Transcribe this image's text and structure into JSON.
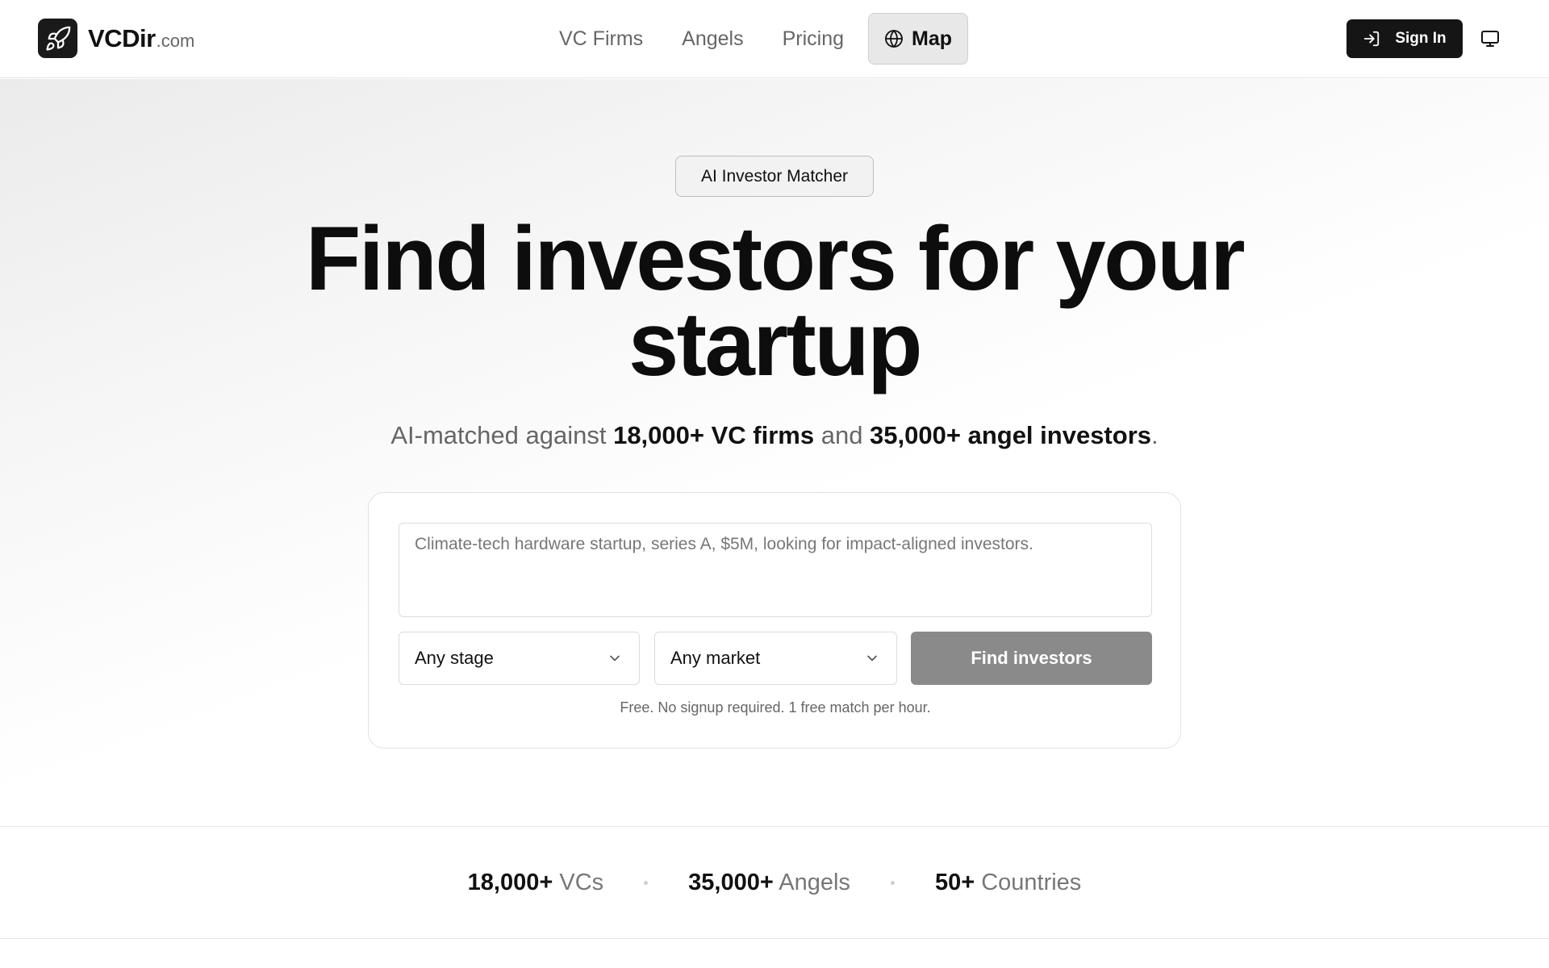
{
  "brand": {
    "name": "VCDir",
    "suffix": ".com",
    "icon": "rocket-icon"
  },
  "nav": {
    "links": [
      {
        "label": "VC Firms"
      },
      {
        "label": "Angels"
      },
      {
        "label": "Pricing"
      }
    ],
    "map": {
      "label": "Map",
      "icon": "globe-icon"
    }
  },
  "header": {
    "sign_in": {
      "label": "Sign In",
      "icon": "log-in-icon"
    },
    "theme_toggle": {
      "icon": "monitor-icon"
    }
  },
  "hero": {
    "badge": "AI Investor Matcher",
    "headline_line1": "Find investors for your",
    "headline_line2": "startup",
    "sub": {
      "prefix": "AI-matched against ",
      "vc_count": "18,000+ VC firms",
      "middle": " and ",
      "angel_count": "35,000+ angel investors",
      "suffix": "."
    }
  },
  "search": {
    "placeholder": "Climate-tech hardware startup, series A, $5M, looking for impact-aligned investors.",
    "value": "",
    "stage": {
      "selected": "Any stage"
    },
    "market": {
      "selected": "Any market"
    },
    "submit_label": "Find investors",
    "note": "Free. No signup required. 1 free match per hour.",
    "submit_color": "#8a8a8a"
  },
  "stats": [
    {
      "value": "18,000+",
      "label": " VCs"
    },
    {
      "value": "35,000+",
      "label": " Angels"
    },
    {
      "value": "50+",
      "label": " Countries"
    }
  ],
  "colors": {
    "primary": "#151515",
    "muted_text": "#666666",
    "border": "#dcdcdc"
  }
}
